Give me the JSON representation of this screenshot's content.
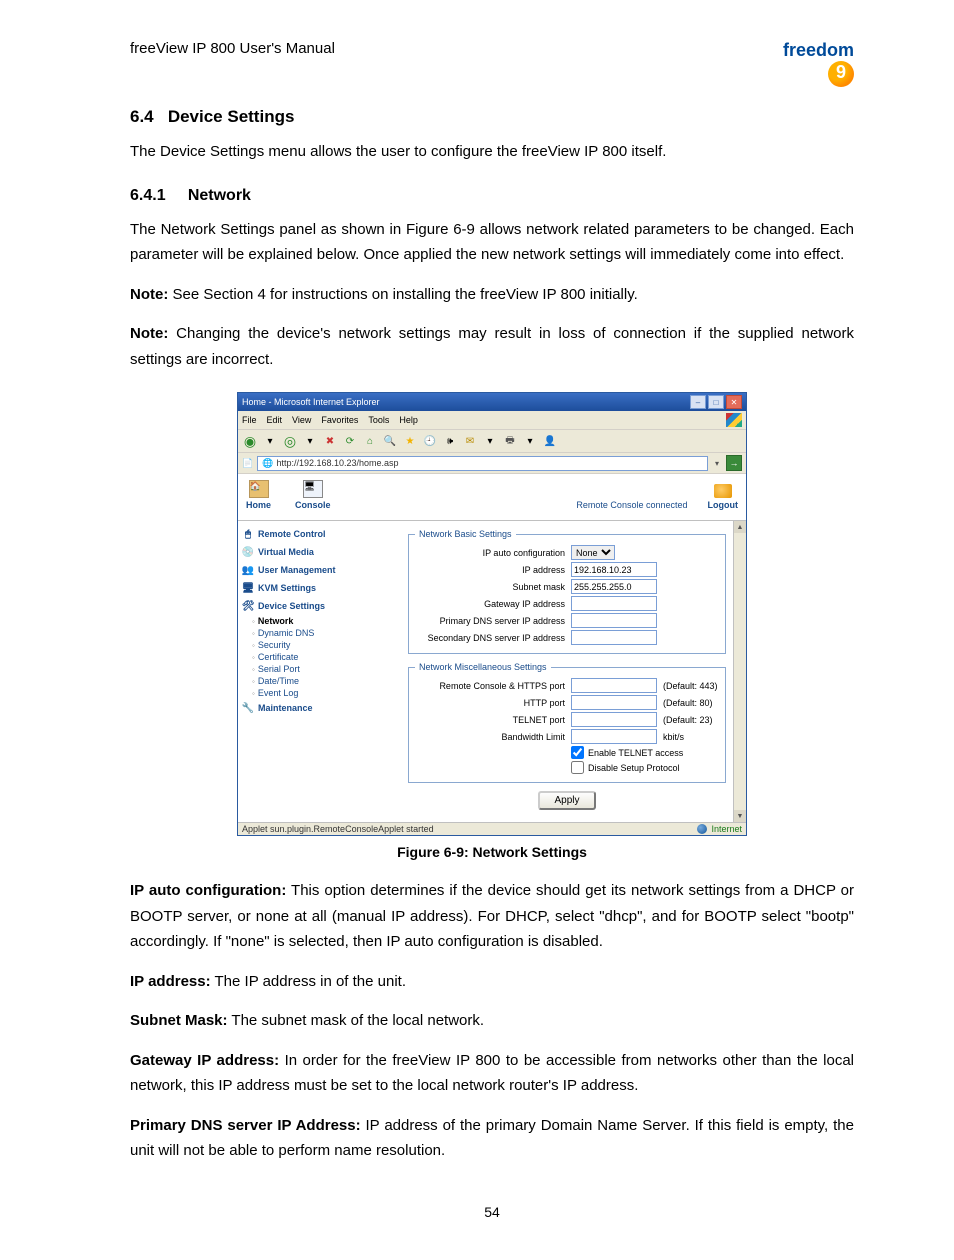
{
  "doc_header": "freeView IP 800 User's Manual",
  "logo_text": "freedom",
  "section": {
    "number": "6.4",
    "title": "Device Settings"
  },
  "intro_para": "The Device Settings menu allows the user to configure the freeView IP 800 itself.",
  "subsection": {
    "number": "6.4.1",
    "title": "Network"
  },
  "network_para": "The Network Settings panel as shown in Figure 6-9 allows network related parameters to be changed. Each parameter will be explained below. Once applied the new network settings will immediately come into effect.",
  "note1_label": "Note:",
  "note1_text": " See Section 4 for instructions on installing the freeView IP 800 initially.",
  "note2_label": "Note:",
  "note2_text": " Changing the device's network settings may result in loss of connection if the supplied network settings are incorrect.",
  "figure_caption": "Figure 6-9: Network Settings",
  "defs": {
    "ip_auto_label": "IP auto configuration:",
    "ip_auto_text": " This option determines if the device should get its network settings from a DHCP or BOOTP server, or none at all (manual IP address). For DHCP, select \"dhcp\", and for BOOTP select \"bootp\" accordingly. If \"none\" is selected, then IP auto configuration is disabled.",
    "ip_addr_label": "IP address:",
    "ip_addr_text": " The IP address in of the unit.",
    "subnet_label": "Subnet Mask:",
    "subnet_text": " The subnet mask of the local network.",
    "gateway_label": "Gateway IP address:",
    "gateway_text": " In order for the freeView IP 800 to be accessible from networks other than the local network, this IP address must be set to the local network router's IP address.",
    "pdns_label": "Primary DNS server IP Address:",
    "pdns_text": " IP address of the primary Domain Name Server. If this field is empty, the unit will not be able to perform name resolution."
  },
  "page_number": "54",
  "ie": {
    "title": "Home - Microsoft Internet Explorer",
    "menus": [
      "File",
      "Edit",
      "View",
      "Favorites",
      "Tools",
      "Help"
    ],
    "address_url": "http://192.168.10.23/home.asp",
    "status_left": "Applet sun.plugin.RemoteConsoleApplet started",
    "status_zone": "Internet"
  },
  "app": {
    "home": "Home",
    "console": "Console",
    "remote_status": "Remote Console connected",
    "logout": "Logout",
    "sidebar": {
      "remote_control": "Remote Control",
      "virtual_media": "Virtual Media",
      "user_mgmt": "User Management",
      "kvm_settings": "KVM Settings",
      "device_settings": "Device Settings",
      "maintenance": "Maintenance",
      "subs": {
        "network": "Network",
        "dyn_dns": "Dynamic DNS",
        "security": "Security",
        "certificate": "Certificate",
        "serial_port": "Serial Port",
        "date_time": "Date/Time",
        "event_log": "Event Log"
      }
    },
    "groups": {
      "basic": "Network Basic Settings",
      "misc": "Network Miscellaneous Settings"
    },
    "fields": {
      "ip_auto": {
        "label": "IP auto configuration",
        "value": "None"
      },
      "ip_addr": {
        "label": "IP address",
        "value": "192.168.10.23"
      },
      "subnet": {
        "label": "Subnet mask",
        "value": "255.255.255.0"
      },
      "gateway": {
        "label": "Gateway IP address",
        "value": ""
      },
      "pdns": {
        "label": "Primary DNS server IP address",
        "value": ""
      },
      "sdns": {
        "label": "Secondary DNS server IP address",
        "value": ""
      },
      "https_port": {
        "label": "Remote Console & HTTPS port",
        "value": "",
        "suffix": "(Default: 443)"
      },
      "http_port": {
        "label": "HTTP port",
        "value": "",
        "suffix": "(Default: 80)"
      },
      "telnet_port": {
        "label": "TELNET port",
        "value": "",
        "suffix": "(Default: 23)"
      },
      "bw_limit": {
        "label": "Bandwidth Limit",
        "value": "",
        "suffix": "kbit/s"
      },
      "enable_telnet": {
        "label": "Enable TELNET access",
        "checked": true
      },
      "disable_setup": {
        "label": "Disable Setup Protocol",
        "checked": false
      }
    },
    "apply": "Apply"
  }
}
